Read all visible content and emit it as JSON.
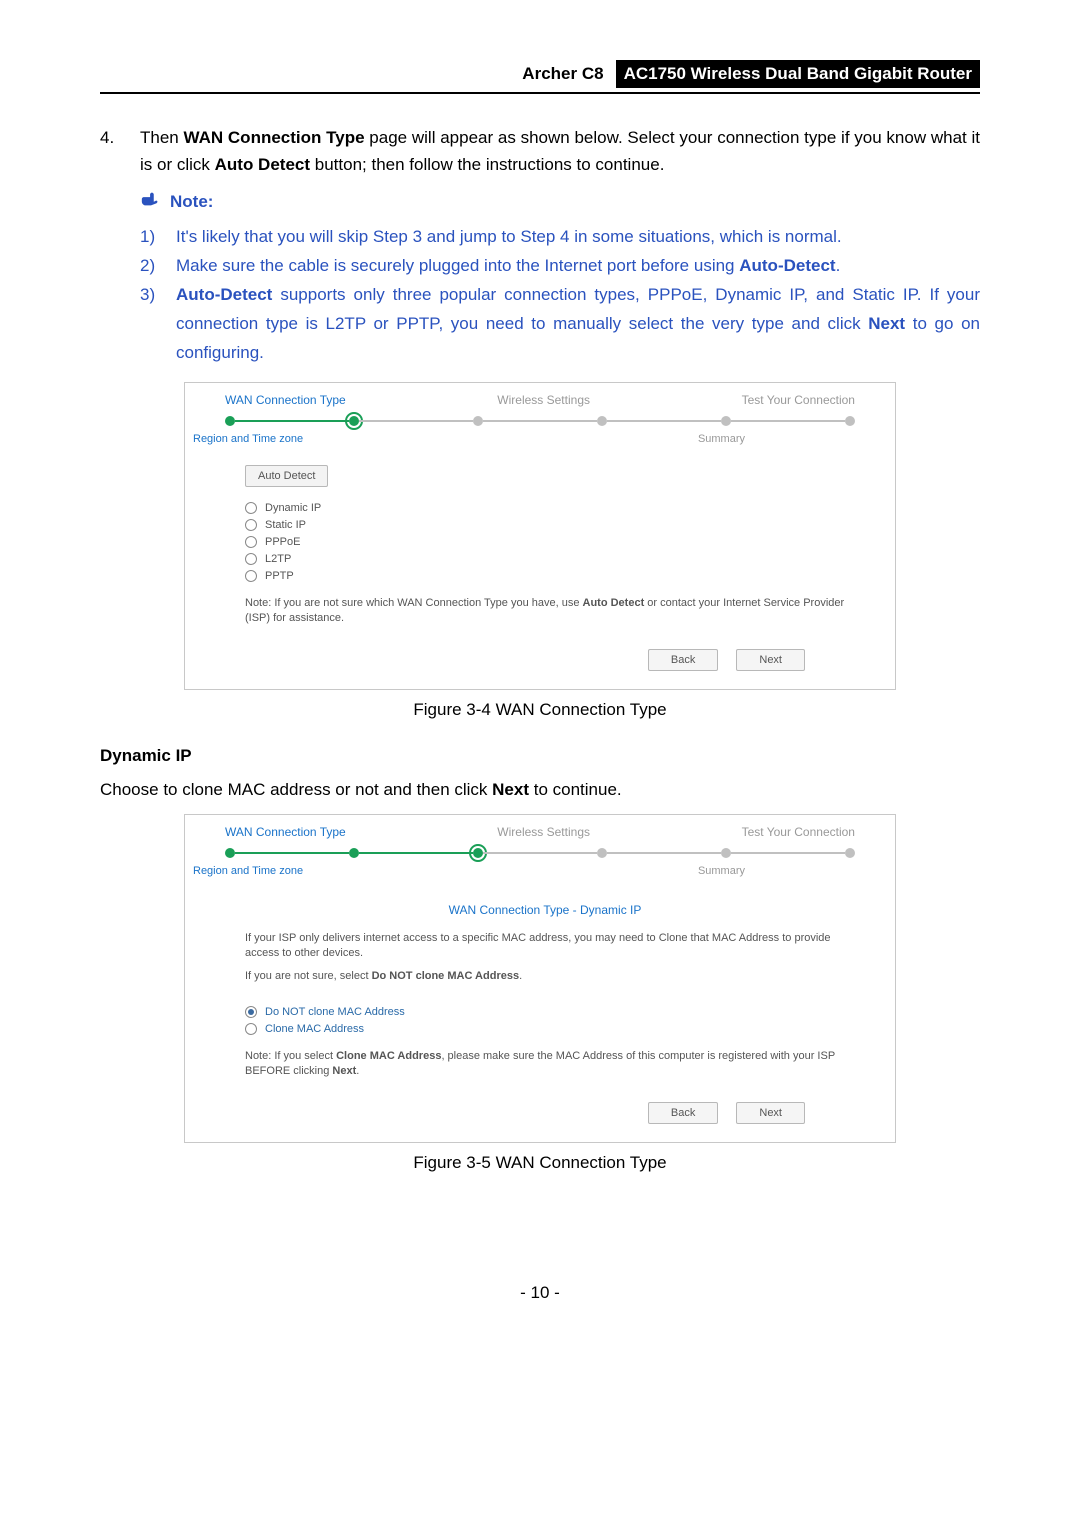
{
  "header": {
    "left": "Archer C8",
    "right": "AC1750 Wireless Dual Band Gigabit Router"
  },
  "intro": {
    "num": "4.",
    "before_bold1": "Then ",
    "bold1": "WAN Connection Type",
    "mid": " page will appear as shown below. Select your connection type if you know what it is or click ",
    "bold2": "Auto Detect",
    "after": " button; then follow the instructions to continue."
  },
  "note_header": "Note:",
  "notes": [
    {
      "num": "1)",
      "text": "It's likely that you will skip Step 3 and jump to Step 4 in some situations, which is normal."
    },
    {
      "num": "2)",
      "pre": "Make sure the cable is securely plugged into the Internet port before using ",
      "bold": "Auto-Detect",
      "post": "."
    },
    {
      "num": "3)",
      "pre": "",
      "bold": "Auto-Detect",
      "post": " supports only three popular connection types, PPPoE, Dynamic IP, and Static IP. If your connection type is L2TP or PPTP, you need to manually select the very type and click ",
      "bold2": "Next",
      "post2": " to go on configuring."
    }
  ],
  "fig1": {
    "tabs": {
      "wan": "WAN Connection Type",
      "wifi": "Wireless Settings",
      "test": "Test Your Connection"
    },
    "subtabs": {
      "region": "Region and Time zone",
      "summary": "Summary"
    },
    "auto_detect": "Auto Detect",
    "radios": [
      "Dynamic IP",
      "Static IP",
      "PPPoE",
      "L2TP",
      "PPTP"
    ],
    "note_pre": "Note: If you are not sure which WAN Connection Type you have, use ",
    "note_bold": "Auto Detect",
    "note_post": " or contact your Internet Service Provider (ISP) for assistance.",
    "back": "Back",
    "next": "Next",
    "caption": "Figure 3-4 WAN Connection Type"
  },
  "dynip": {
    "heading": "Dynamic IP",
    "line_pre": "Choose to clone MAC address or not and then click ",
    "line_bold": "Next",
    "line_post": " to continue."
  },
  "fig2": {
    "tabs": {
      "wan": "WAN Connection Type",
      "wifi": "Wireless Settings",
      "test": "Test Your Connection"
    },
    "subtabs": {
      "region": "Region and Time zone",
      "summary": "Summary"
    },
    "title": "WAN Connection Type - Dynamic IP",
    "p1": "If your ISP only delivers internet access to a specific MAC address, you may need to Clone that MAC Address to provide access to other devices.",
    "p2_pre": "If you are not sure, select ",
    "p2_bold": "Do NOT clone MAC Address",
    "p2_post": ".",
    "radios": [
      "Do NOT clone MAC Address",
      "Clone MAC Address"
    ],
    "note_pre": "Note: If you select ",
    "note_bold1": "Clone MAC Address",
    "note_mid": ", please make sure the MAC Address of this computer is registered with your ISP BEFORE clicking ",
    "note_bold2": "Next",
    "note_post": ".",
    "back": "Back",
    "next": "Next",
    "caption": "Figure 3-5 WAN Connection Type"
  },
  "page_number": "- 10 -",
  "chart_data": null
}
